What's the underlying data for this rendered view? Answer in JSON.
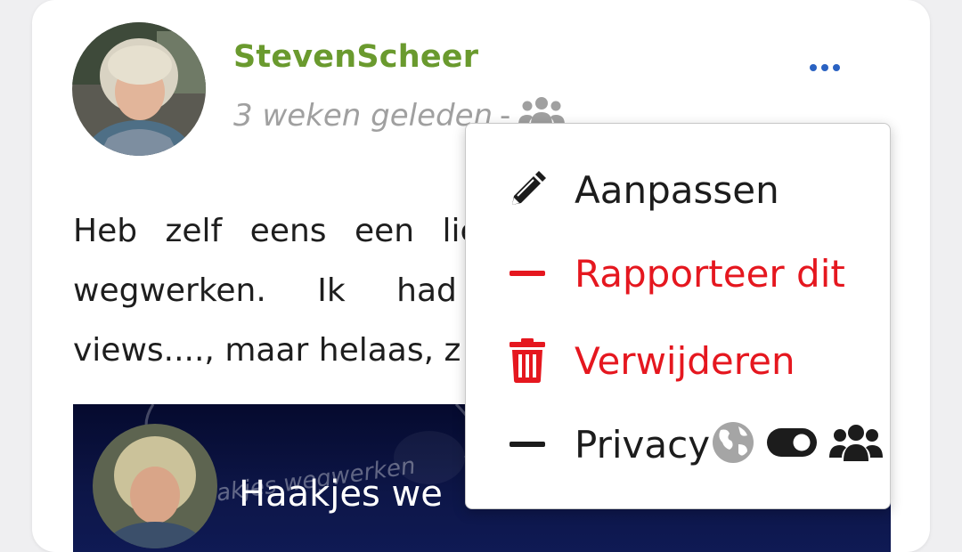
{
  "post": {
    "username": "StevenScheer",
    "timestamp": "3 weken geleden",
    "separator": "-",
    "audience_icon": "users-icon",
    "text_lines": [
      "Heb zelf eens een lie",
      "wegwerken. Ik had",
      "views...., maar helaas, z"
    ],
    "video": {
      "watermark": "akjes wegwerken",
      "title": "Haakjes we"
    }
  },
  "menu": {
    "items": [
      {
        "label": "Aanpassen",
        "icon": "pencil-icon",
        "color": "#1c1c1c"
      },
      {
        "label": "Rapporteer dit",
        "icon": "minus-icon",
        "color": "#e5171f"
      },
      {
        "label": "Verwijderen",
        "icon": "trash-icon",
        "color": "#e5171f"
      },
      {
        "label": "Privacy",
        "icon": "minus-icon",
        "color": "#1c1c1c",
        "privacy_icons": [
          "globe-icon",
          "toggle-icon",
          "users-icon"
        ]
      }
    ]
  },
  "colors": {
    "username": "#6a9a2e",
    "accent_dots": "#2a62c2",
    "danger": "#e5171f"
  }
}
